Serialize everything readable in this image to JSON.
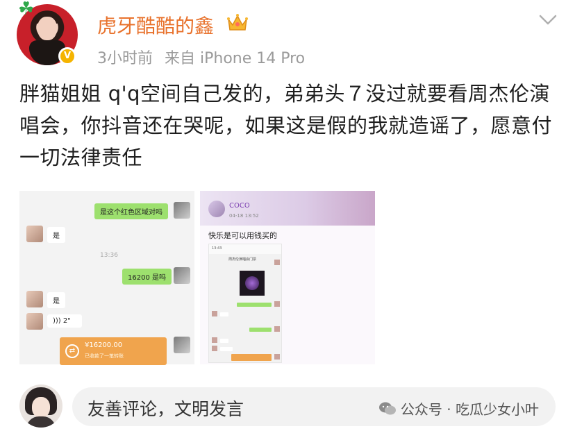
{
  "header": {
    "username": "虎牙酷酷的鑫",
    "time": "3小时前",
    "source": "来自 iPhone 14 Pro"
  },
  "post": {
    "text": "胖猫姐姐 q'q空间自己发的，弟弟头７没过就要看周杰伦演唱会，你抖音还在哭呢，如果这是假的我就造谣了，愿意付一切法律责任"
  },
  "image1": {
    "msg1": "是这个红色区域对吗",
    "reply1": "是",
    "timestamp": "13:36",
    "msg2": "16200 是吗",
    "reply2": "是",
    "voice": "2\"",
    "transfer_amount": "¥16200.00",
    "transfer_sub": "已收款了一笔转账"
  },
  "image2": {
    "name": "COCO",
    "date": "04-18 13:52",
    "text": "快乐是可以用钱买的",
    "phone_time": "13:43",
    "phone_title": "周杰伦演唱会门票"
  },
  "footer": {
    "comment_placeholder": "友善评论，文明发言",
    "watermark": "公众号 · 吃瓜少女小叶"
  },
  "colors": {
    "username": "#e8712b",
    "vip_badge": "#f5b400",
    "wechat_green": "#9de06e",
    "transfer_orange": "#f0a44d"
  }
}
